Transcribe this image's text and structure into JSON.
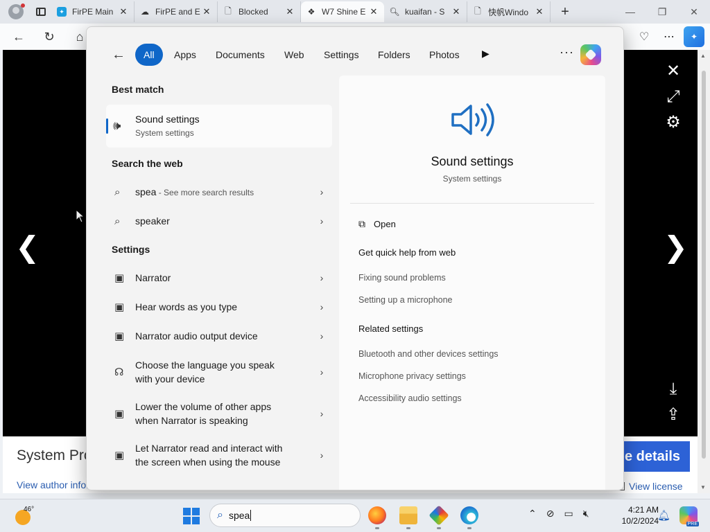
{
  "browser": {
    "tabs": [
      {
        "label": "FirPE Main",
        "icon": "sparkle-app-icon",
        "active": false
      },
      {
        "label": "FirPE and E",
        "icon": "cloud-icon",
        "active": false
      },
      {
        "label": "Blocked",
        "icon": "document-icon",
        "active": false
      },
      {
        "label": "W7 Shine E",
        "icon": "logo-icon",
        "active": true
      },
      {
        "label": "kuaifan - S",
        "icon": "search-icon",
        "active": false
      },
      {
        "label": "快帆Windo",
        "icon": "document-icon",
        "active": false
      }
    ],
    "close_glyph": "✕",
    "new_tab_glyph": "+",
    "window_controls": {
      "minimize": "—",
      "restore": "❐",
      "close": "✕"
    }
  },
  "page": {
    "title_partial": "System Pro",
    "author_link_partial": "View author infor",
    "details_button_partial": "e details",
    "license_link": "View license"
  },
  "search": {
    "filters": [
      "All",
      "Apps",
      "Documents",
      "Web",
      "Settings",
      "Folders",
      "Photos"
    ],
    "active_filter": "All",
    "best_match_heading": "Best match",
    "best_match": {
      "title": "Sound settings",
      "subtitle": "System settings"
    },
    "web_heading": "Search the web",
    "web_results": [
      {
        "query": "spea",
        "hint": " - See more search results"
      },
      {
        "query": "speaker",
        "hint": ""
      }
    ],
    "settings_heading": "Settings",
    "settings_results": [
      {
        "label": "Narrator",
        "icon": "narrator-settings-icon"
      },
      {
        "label": "Hear words as you type",
        "icon": "narrator-settings-icon"
      },
      {
        "label": "Narrator audio output device",
        "icon": "narrator-settings-icon"
      },
      {
        "label": "Choose the language you speak with your device",
        "icon": "speech-icon"
      },
      {
        "label": "Lower the volume of other apps when Narrator is speaking",
        "icon": "narrator-settings-icon"
      },
      {
        "label": "Let Narrator read and interact with the screen when using the mouse",
        "icon": "narrator-settings-icon"
      }
    ],
    "preview": {
      "title": "Sound settings",
      "subtitle": "System settings",
      "open_label": "Open",
      "quick_help_heading": "Get quick help from web",
      "quick_help_links": [
        "Fixing sound problems",
        "Setting up a microphone"
      ],
      "related_heading": "Related settings",
      "related_links": [
        "Bluetooth and other devices settings",
        "Microphone privacy settings",
        "Accessibility audio settings"
      ]
    }
  },
  "taskbar": {
    "weather_temp": "46°",
    "search_value": "spea",
    "clock_time": "4:21 AM",
    "clock_date": "10/2/2024",
    "copilot_badge": "PRE"
  },
  "colors": {
    "accent": "#0f66c8",
    "panel_bg": "#f3f3f3",
    "details_button": "#2d62d6",
    "link": "#2a5db0"
  }
}
